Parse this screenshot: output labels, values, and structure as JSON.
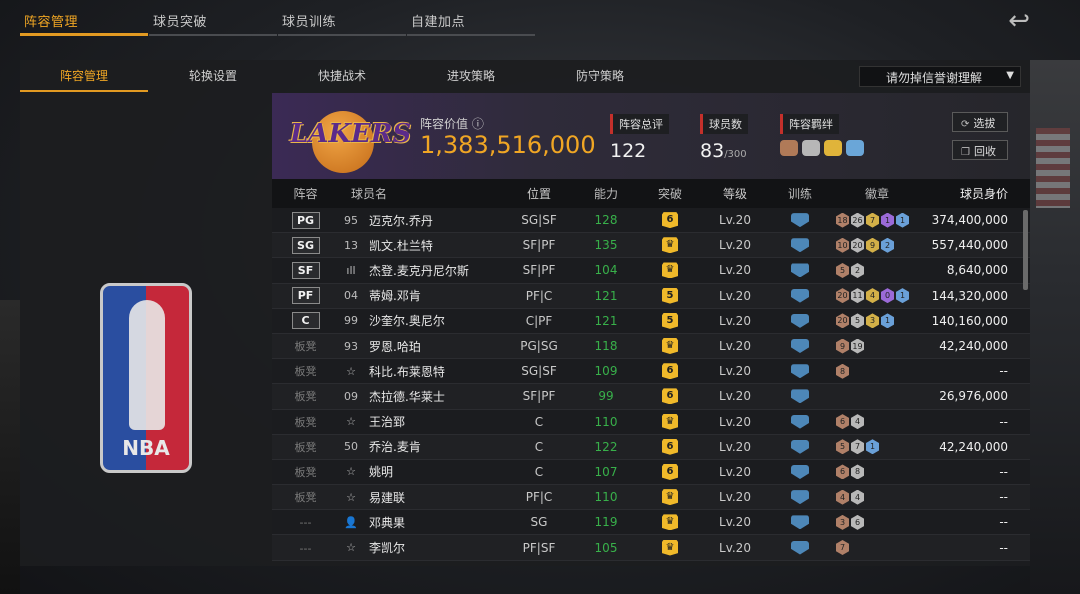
{
  "top_tabs": [
    "阵容管理",
    "球员突破",
    "球员训练",
    "自建加点"
  ],
  "back_icon": "↩",
  "sub_tabs": [
    "阵容管理",
    "轮换设置",
    "快捷战术",
    "进攻策略",
    "防守策略"
  ],
  "dropdown_value": "请勿掉信誉谢理解",
  "team": {
    "logo_text": "LAKERS",
    "value_label": "阵容价值",
    "value": "1,383,516,000",
    "rating_label": "阵容总评",
    "rating": "122",
    "player_count_label": "球员数",
    "player_count": "83",
    "player_count_max": "/300",
    "bond_label": "阵容羁绊",
    "bond_colors": [
      "#b07a58",
      "#b7b7b7",
      "#e0b43a",
      "#6aa6d8"
    ]
  },
  "buttons": {
    "select": "选拔",
    "recycle": "回收"
  },
  "columns": [
    "阵容",
    "球员名",
    "位置",
    "能力",
    "突破",
    "等级",
    "训练",
    "徽章",
    "球员身价"
  ],
  "logo_text": "NBA",
  "rows": [
    {
      "slot": "PG",
      "starter": true,
      "jersey": "95",
      "name": "迈克尔.乔丹",
      "pos": "SG|SF",
      "ovr": "128",
      "brk": "6",
      "lvl": "Lv.20",
      "badges": [
        [
          "bronze",
          "18"
        ],
        [
          "silver",
          "26"
        ],
        [
          "gold",
          "7"
        ],
        [
          "purple",
          "1"
        ],
        [
          "blue",
          "1"
        ]
      ],
      "price": "374,400,000"
    },
    {
      "slot": "SG",
      "starter": true,
      "jersey": "13",
      "name": "凯文.杜兰特",
      "pos": "SF|PF",
      "ovr": "135",
      "brk": "♛",
      "lvl": "Lv.20",
      "badges": [
        [
          "bronze",
          "10"
        ],
        [
          "silver",
          "20"
        ],
        [
          "gold",
          "9"
        ],
        [
          "blue",
          "2"
        ]
      ],
      "price": "557,440,000"
    },
    {
      "slot": "SF",
      "starter": true,
      "jersey": "ıll",
      "name": "杰登.麦克丹尼尔斯",
      "pos": "SF|PF",
      "ovr": "104",
      "brk": "♛",
      "lvl": "Lv.20",
      "badges": [
        [
          "bronze",
          "5"
        ],
        [
          "silver",
          "2"
        ]
      ],
      "price": "8,640,000"
    },
    {
      "slot": "PF",
      "starter": true,
      "jersey": "04",
      "name": "蒂姆.邓肯",
      "pos": "PF|C",
      "ovr": "121",
      "brk": "5",
      "lvl": "Lv.20",
      "badges": [
        [
          "bronze",
          "20"
        ],
        [
          "silver",
          "11"
        ],
        [
          "gold",
          "4"
        ],
        [
          "purple",
          "0"
        ],
        [
          "blue",
          "1"
        ]
      ],
      "price": "144,320,000"
    },
    {
      "slot": "C",
      "starter": true,
      "jersey": "99",
      "name": "沙奎尔.奥尼尔",
      "pos": "C|PF",
      "ovr": "121",
      "brk": "5",
      "lvl": "Lv.20",
      "badges": [
        [
          "bronze",
          "20"
        ],
        [
          "silver",
          "5"
        ],
        [
          "gold",
          "3"
        ],
        [
          "blue",
          "1"
        ]
      ],
      "price": "140,160,000"
    },
    {
      "slot": "板凳",
      "starter": false,
      "jersey": "93",
      "name": "罗恩.哈珀",
      "pos": "PG|SG",
      "ovr": "118",
      "brk": "♛",
      "lvl": "Lv.20",
      "badges": [
        [
          "bronze",
          "9"
        ],
        [
          "silver",
          "19"
        ]
      ],
      "price": "42,240,000"
    },
    {
      "slot": "板凳",
      "starter": false,
      "jersey": "☆",
      "name": "科比.布莱恩特",
      "pos": "SG|SF",
      "ovr": "109",
      "brk": "6",
      "lvl": "Lv.20",
      "badges": [
        [
          "bronze",
          "8"
        ]
      ],
      "price": "--"
    },
    {
      "slot": "板凳",
      "starter": false,
      "jersey": "09",
      "name": "杰拉德.华莱士",
      "pos": "SF|PF",
      "ovr": "99",
      "brk": "6",
      "lvl": "Lv.20",
      "badges": [],
      "price": "26,976,000"
    },
    {
      "slot": "板凳",
      "starter": false,
      "jersey": "☆",
      "name": "王治郅",
      "pos": "C",
      "ovr": "110",
      "brk": "♛",
      "lvl": "Lv.20",
      "badges": [
        [
          "bronze",
          "6"
        ],
        [
          "silver",
          "4"
        ]
      ],
      "price": "--"
    },
    {
      "slot": "板凳",
      "starter": false,
      "jersey": "50",
      "name": "乔治.麦肯",
      "pos": "C",
      "ovr": "122",
      "brk": "6",
      "lvl": "Lv.20",
      "badges": [
        [
          "bronze",
          "5"
        ],
        [
          "silver",
          "7"
        ],
        [
          "blue",
          "1"
        ]
      ],
      "price": "42,240,000"
    },
    {
      "slot": "板凳",
      "starter": false,
      "jersey": "☆",
      "name": "姚明",
      "pos": "C",
      "ovr": "107",
      "brk": "6",
      "lvl": "Lv.20",
      "badges": [
        [
          "bronze",
          "6"
        ],
        [
          "silver",
          "8"
        ]
      ],
      "price": "--"
    },
    {
      "slot": "板凳",
      "starter": false,
      "jersey": "☆",
      "name": "易建联",
      "pos": "PF|C",
      "ovr": "110",
      "brk": "♛",
      "lvl": "Lv.20",
      "badges": [
        [
          "bronze",
          "4"
        ],
        [
          "silver",
          "4"
        ]
      ],
      "price": "--"
    },
    {
      "slot": "---",
      "starter": false,
      "jersey": "👤",
      "name": "邓典果",
      "pos": "SG",
      "ovr": "119",
      "brk": "♛",
      "lvl": "Lv.20",
      "badges": [
        [
          "bronze",
          "3"
        ],
        [
          "silver",
          "6"
        ]
      ],
      "price": "--"
    },
    {
      "slot": "---",
      "starter": false,
      "jersey": "☆",
      "name": "李凯尔",
      "pos": "PF|SF",
      "ovr": "105",
      "brk": "♛",
      "lvl": "Lv.20",
      "badges": [
        [
          "bronze",
          "7"
        ]
      ],
      "price": "--"
    }
  ]
}
